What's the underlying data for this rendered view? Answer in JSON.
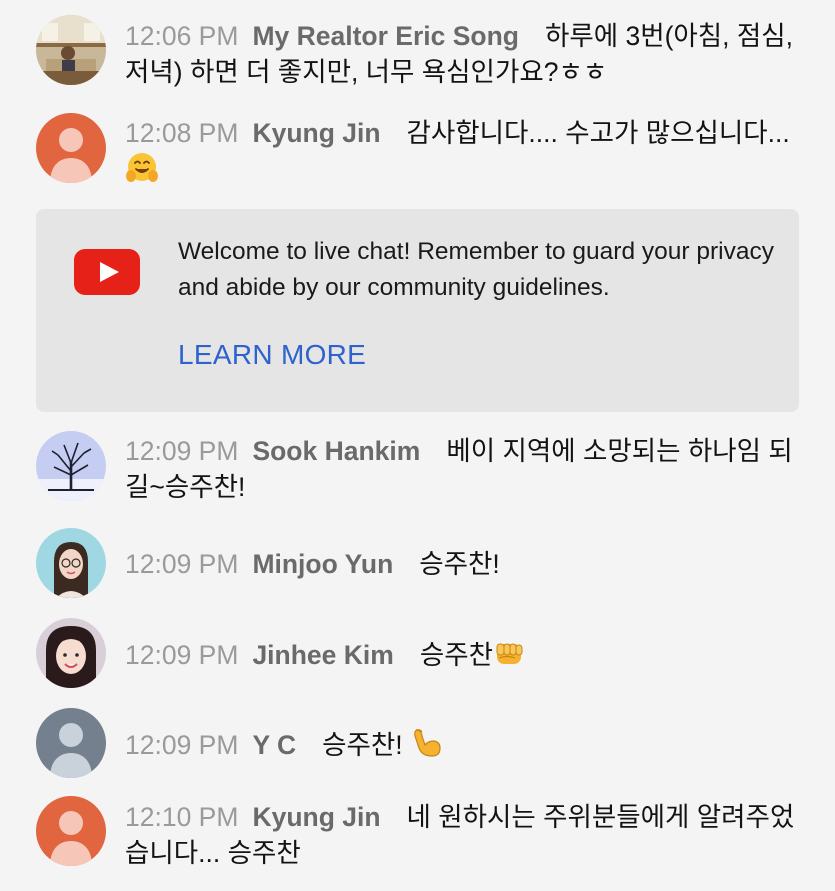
{
  "messages": [
    {
      "time": "12:06 PM",
      "author": "My Realtor Eric Song",
      "text": "하루에 3번(아침, 점심, 저녁) 하면 더 좋지만, 너무 욕심인가요?ㅎㅎ",
      "emoji": "",
      "avatar_icon": "house-photo-avatar"
    },
    {
      "time": "12:08 PM",
      "author": "Kyung Jin",
      "text": "감사합니다.... 수고가 많으십니다...",
      "emoji": "hugging-face",
      "avatar_icon": "default-person-avatar",
      "avatar_color": "#e1653f"
    },
    {
      "time": "12:09 PM",
      "author": "Sook Hankim",
      "text": "베이 지역에 소망되는 하나임 되길~승주찬!",
      "emoji": "",
      "avatar_icon": "winter-tree-photo-avatar"
    },
    {
      "time": "12:09 PM",
      "author": "Minjoo Yun",
      "text": "승주찬!",
      "emoji": "",
      "avatar_icon": "woman-glasses-photo-avatar"
    },
    {
      "time": "12:09 PM",
      "author": "Jinhee Kim",
      "text": "승주찬",
      "emoji": "oncoming-fist",
      "avatar_icon": "woman-photo-avatar"
    },
    {
      "time": "12:09 PM",
      "author": "Y C",
      "text": "승주찬! ",
      "emoji": "flexed-biceps",
      "avatar_icon": "default-person-avatar",
      "avatar_color": "#75808e"
    },
    {
      "time": "12:10 PM",
      "author": "Kyung Jin",
      "text": "네 원하시는 주위분들에게 알려주었습니다... 승주찬",
      "emoji": "",
      "avatar_icon": "default-person-avatar",
      "avatar_color": "#e1653f"
    }
  ],
  "banner": {
    "icon": "youtube-logo-icon",
    "text": "Welcome to live chat! Remember to guard your privacy and abide by our community guidelines.",
    "learn_more": "LEARN MORE",
    "accent": "#2e62cf",
    "logo_color": "#e62117"
  },
  "colors": {
    "background": "#f4f4f4",
    "timestamp": "#9a9a9a",
    "author": "#6a6a6a",
    "banner_bg": "#e5e5e5"
  }
}
